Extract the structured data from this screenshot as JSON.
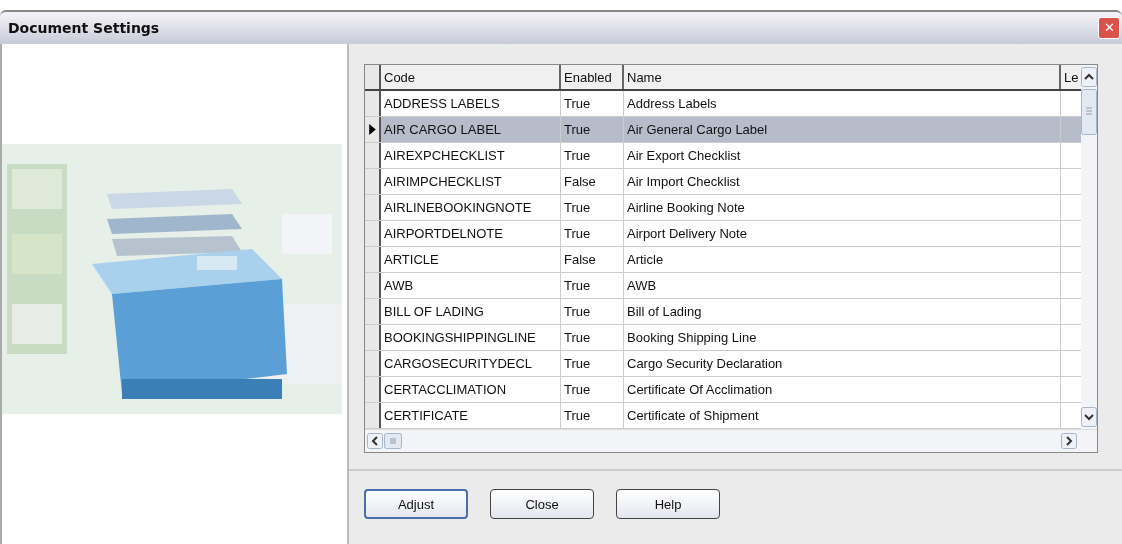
{
  "window": {
    "title": "Document Settings",
    "close_glyph": "✕"
  },
  "table": {
    "columns": [
      "Code",
      "Enabled",
      "Name",
      "Le"
    ],
    "rows": [
      {
        "code": "ADDRESS LABELS",
        "enabled": "True",
        "name": "Address Labels",
        "selected": false
      },
      {
        "code": "AIR CARGO LABEL",
        "enabled": "True",
        "name": "Air General Cargo Label",
        "selected": true
      },
      {
        "code": "AIREXPCHECKLIST",
        "enabled": "True",
        "name": "Air Export Checklist",
        "selected": false
      },
      {
        "code": "AIRIMPCHECKLIST",
        "enabled": "False",
        "name": "Air Import Checklist",
        "selected": false
      },
      {
        "code": "AIRLINEBOOKINGNOTE",
        "enabled": "True",
        "name": "Airline Booking Note",
        "selected": false
      },
      {
        "code": "AIRPORTDELNOTE",
        "enabled": "True",
        "name": "Airport Delivery Note",
        "selected": false
      },
      {
        "code": "ARTICLE",
        "enabled": "False",
        "name": "Article",
        "selected": false
      },
      {
        "code": "AWB",
        "enabled": "True",
        "name": "AWB",
        "selected": false
      },
      {
        "code": "BILL OF LADING",
        "enabled": "True",
        "name": "Bill of Lading",
        "selected": false
      },
      {
        "code": "BOOKINGSHIPPINGLINE",
        "enabled": "True",
        "name": "Booking Shipping Line",
        "selected": false
      },
      {
        "code": "CARGOSECURITYDECL",
        "enabled": "True",
        "name": "Cargo Security Declaration",
        "selected": false
      },
      {
        "code": "CERTACCLIMATION",
        "enabled": "True",
        "name": "Certificate Of Acclimation",
        "selected": false
      },
      {
        "code": "CERTIFICATE",
        "enabled": "True",
        "name": "Certificate of Shipment",
        "selected": false
      }
    ]
  },
  "buttons": [
    "Adjust",
    "Close",
    "Help"
  ]
}
